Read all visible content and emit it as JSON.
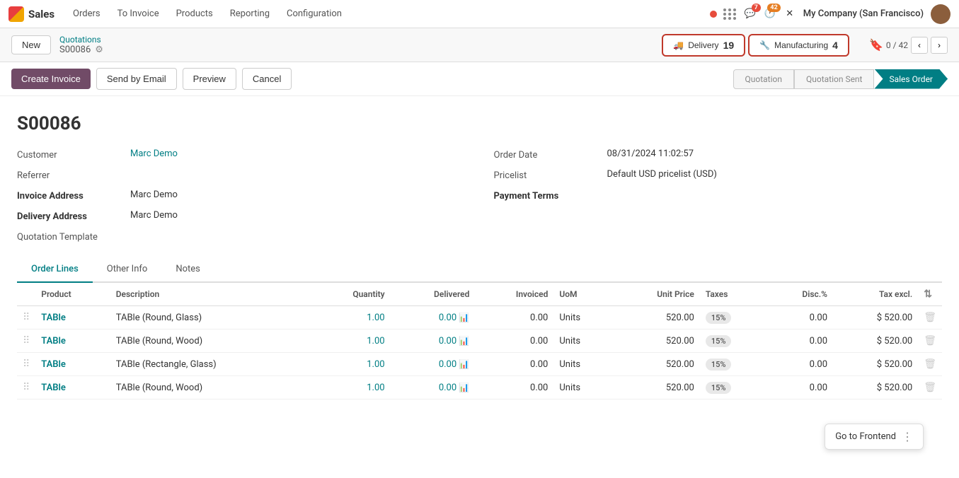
{
  "topnav": {
    "app_name": "Sales",
    "menu_items": [
      "Orders",
      "To Invoice",
      "Products",
      "Reporting",
      "Configuration"
    ],
    "active_item": "Sales",
    "company": "My Company (San Francisco)",
    "notifications": {
      "messages": "7",
      "activity": "42"
    }
  },
  "breadcrumb": {
    "parent": "Quotations",
    "record_id": "S00086",
    "new_label": "New"
  },
  "smart_buttons": {
    "delivery": {
      "label": "Delivery",
      "count": "19"
    },
    "manufacturing": {
      "label": "Manufacturing",
      "count": "4"
    }
  },
  "pagination": {
    "bookmark": "🔖",
    "current": "0 / 42",
    "prev": "‹",
    "next": "›"
  },
  "action_bar": {
    "create_invoice": "Create Invoice",
    "send_email": "Send by Email",
    "preview": "Preview",
    "cancel": "Cancel"
  },
  "status_pills": [
    {
      "label": "Quotation",
      "active": false
    },
    {
      "label": "Quotation Sent",
      "active": false
    },
    {
      "label": "Sales Order",
      "active": true
    }
  ],
  "order": {
    "title": "S00086",
    "customer_label": "Customer",
    "customer_value": "Marc Demo",
    "referrer_label": "Referrer",
    "invoice_address_label": "Invoice Address",
    "invoice_address_value": "Marc Demo",
    "delivery_address_label": "Delivery Address",
    "delivery_address_value": "Marc Demo",
    "quotation_template_label": "Quotation Template",
    "order_date_label": "Order Date",
    "order_date_value": "08/31/2024 11:02:57",
    "pricelist_label": "Pricelist",
    "pricelist_value": "Default USD pricelist (USD)",
    "payment_terms_label": "Payment Terms"
  },
  "tabs": [
    {
      "label": "Order Lines",
      "active": true
    },
    {
      "label": "Other Info",
      "active": false
    },
    {
      "label": "Notes",
      "active": false
    }
  ],
  "table": {
    "headers": [
      "Product",
      "Description",
      "Quantity",
      "Delivered",
      "Invoiced",
      "UoM",
      "Unit Price",
      "Taxes",
      "Disc.%",
      "Tax excl."
    ],
    "rows": [
      {
        "product": "TABle",
        "description": "TABle (Round, Glass)",
        "quantity": "1.00",
        "delivered": "0.00",
        "invoiced": "0.00",
        "uom": "Units",
        "unit_price": "520.00",
        "tax": "15%",
        "disc": "0.00",
        "tax_excl": "$ 520.00"
      },
      {
        "product": "TABle",
        "description": "TABle (Round, Wood)",
        "quantity": "1.00",
        "delivered": "0.00",
        "invoiced": "0.00",
        "uom": "Units",
        "unit_price": "520.00",
        "tax": "15%",
        "disc": "0.00",
        "tax_excl": "$ 520.00"
      },
      {
        "product": "TABle",
        "description": "TABle (Rectangle, Glass)",
        "quantity": "1.00",
        "delivered": "0.00",
        "invoiced": "0.00",
        "uom": "Units",
        "unit_price": "520.00",
        "tax": "15%",
        "disc": "0.00",
        "tax_excl": "$ 520.00"
      },
      {
        "product": "TABle",
        "description": "TABle (Round, Wood)",
        "quantity": "1.00",
        "delivered": "0.00",
        "invoiced": "0.00",
        "uom": "Units",
        "unit_price": "520.00",
        "tax": "15%",
        "disc": "0.00",
        "tax_excl": "$ 520.00"
      }
    ]
  },
  "goto_frontend": "Go to Frontend"
}
